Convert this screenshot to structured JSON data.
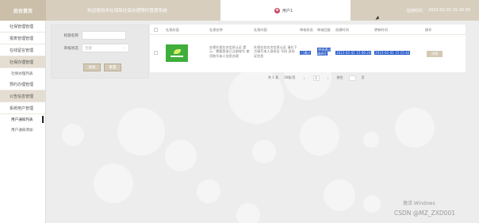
{
  "header": {
    "brand": "后台首页",
    "welcome": "欢迎使用市社保局社保办理预约管理系统",
    "user_name": "用户1",
    "time_label": "当前时间：",
    "time_value": "2023-02-02 15:16:30"
  },
  "sidebar": {
    "items": [
      {
        "label": "社保管理管理",
        "type": "group"
      },
      {
        "label": "报表管理管理",
        "type": "group"
      },
      {
        "label": "在线留言管理",
        "type": "group"
      },
      {
        "label": "社保办理管理",
        "type": "group"
      },
      {
        "label": "社保办理列表",
        "type": "sub"
      },
      {
        "label": "预约办理管理",
        "type": "group"
      },
      {
        "label": "公告信息管理",
        "type": "group"
      },
      {
        "label": "系统用户管理",
        "type": "group"
      },
      {
        "label": "用户通知列表",
        "type": "sub",
        "active": true
      },
      {
        "label": "用户通知添加",
        "type": "sub"
      }
    ]
  },
  "search": {
    "title_label": "标题名称",
    "title_placeholder": "",
    "status_label": "审核状态",
    "status_selected": "全部",
    "search_button": "搜索",
    "reset_button": "重置"
  },
  "table": {
    "headers": [
      "社保封面",
      "社保名称",
      "社保内容",
      "审核状态",
      "审核回复",
      "创建时间",
      "更新时间",
      "操作"
    ],
    "rows": [
      {
        "image": "social-security-cover",
        "name": "办理社保实名信息认证 提示：需要登录已注册账号 使用账号本人信息办理",
        "content": "社保业务实名信息认证 请在下方填写本人身份证 号码 身份证信息",
        "status": "已通过",
        "reply": "审核通过 请前往",
        "created": "2023-02-02 15:06:24",
        "updated": "2023-02-02 15:15:42",
        "action": "详情"
      }
    ]
  },
  "pagination": {
    "total": "共 1 条",
    "page_size": "10条/页",
    "prev": "‹",
    "current": "1",
    "next": "›",
    "goto": "前往",
    "page_unit": "页"
  },
  "overlay": {
    "activate": "激活 Windows",
    "watermark": "CSDN @MZ_ZXD001"
  }
}
